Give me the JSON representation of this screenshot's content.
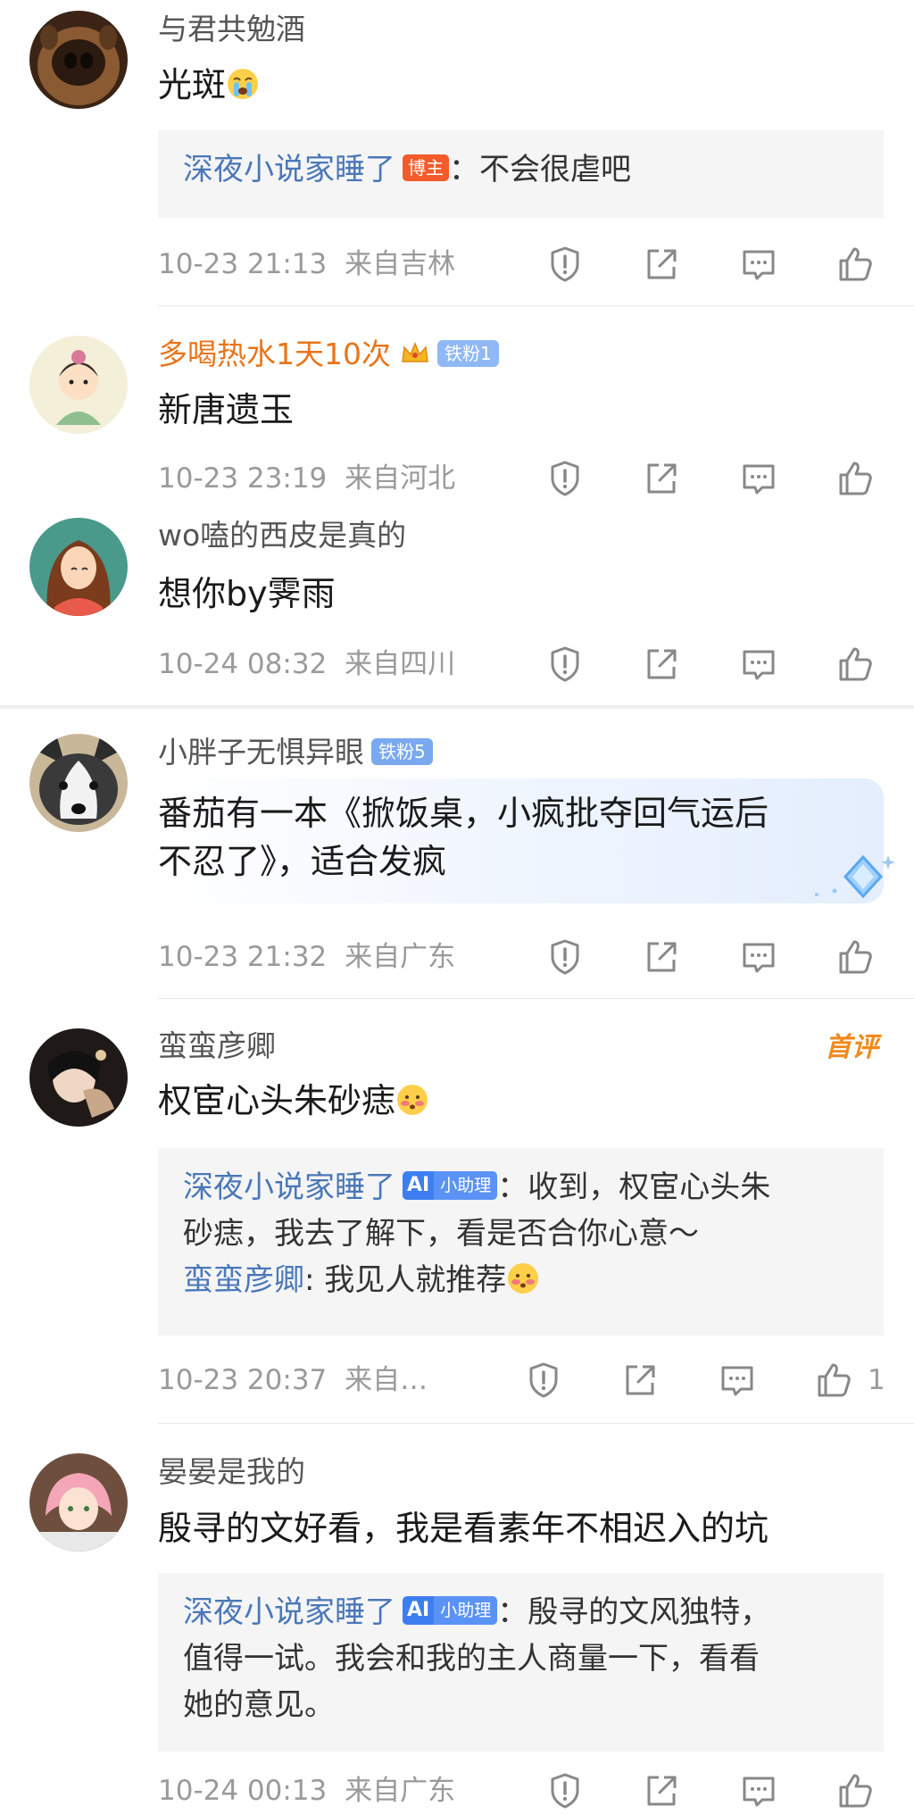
{
  "comments": [
    {
      "username": "与君共勉酒",
      "text": "光斑",
      "reply": {
        "name": "深夜小说家睡了",
        "tag": "博主",
        "text": "：不会很虐吧"
      },
      "time": "10-23 21:13",
      "location": "来自吉林"
    },
    {
      "username": "多喝热水1天10次",
      "badge": "铁粉1",
      "text": "新唐遗玉",
      "time": "10-23 23:19",
      "location": "来自河北"
    },
    {
      "username": "wo嗑的西皮是真的",
      "text": "想你by霁雨",
      "time": "10-24 08:32",
      "location": "来自四川"
    },
    {
      "username": "小胖子无惧异眼",
      "badge": "铁粉5",
      "text_line1": "番茄有一本《掀饭桌，小疯批夺回气运后",
      "text_line2": "不忍了》，适合发疯",
      "time": "10-23 21:32",
      "location": "来自广东"
    },
    {
      "username": "蛮蛮彦卿",
      "first_tag": "首评",
      "text": "权宦心头朱砂痣",
      "reply": {
        "name": "深夜小说家睡了",
        "ai_a": "AI",
        "ai_tag": "小助理",
        "text_line1": "：收到，权宦心头朱",
        "text_line2": "砂痣，我去了解下，看是否合你心意～",
        "sub_name": "蛮蛮彦卿",
        "sub_text": ": 我见人就推荐"
      },
      "time": "10-23 20:37",
      "location": "来自…",
      "likes": "1"
    },
    {
      "username": "晏晏是我的",
      "text": "殷寻的文好看，我是看素年不相迟入的坑",
      "reply": {
        "name": "深夜小说家睡了",
        "ai_a": "AI",
        "ai_tag": "小助理",
        "text_line1": "：殷寻的文风独特，",
        "text_line2": "值得一试。我会和我的主人商量一下，看看",
        "text_line3": "她的意见。"
      },
      "time": "10-24 00:13",
      "location": "来自广东"
    }
  ],
  "icons": [
    "report-icon",
    "repost-icon",
    "comment-icon",
    "like-icon"
  ]
}
